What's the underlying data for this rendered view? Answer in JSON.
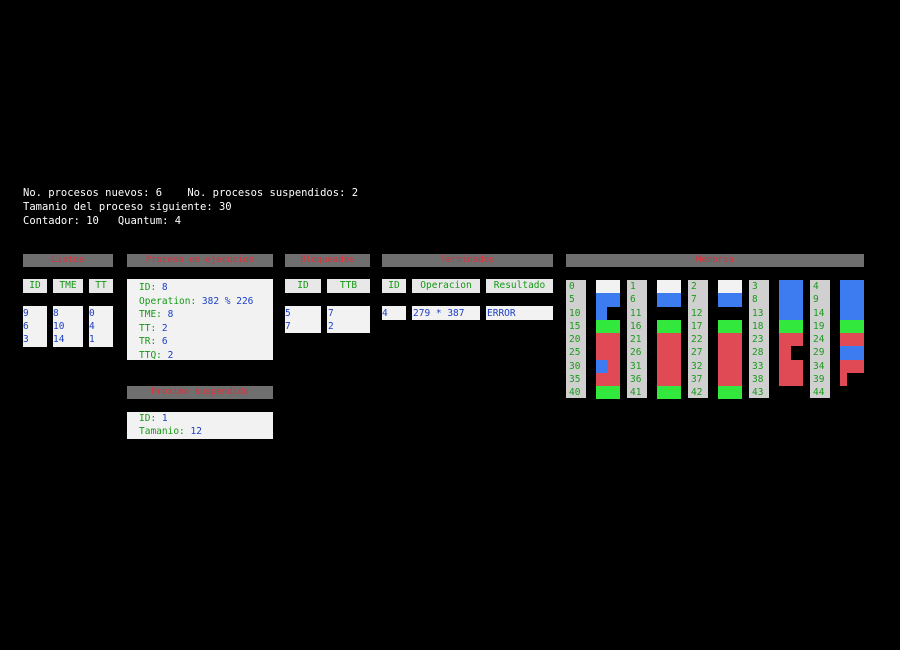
{
  "info": {
    "line1": "No. procesos nuevos: 6    No. procesos suspendidos: 2",
    "line2": "Tamanio del proceso siguiente: 30",
    "line3": "Contador: 10   Quantum: 4"
  },
  "listos": {
    "title": "Listos",
    "columns": [
      "ID",
      "TME",
      "TT"
    ],
    "rows": [
      [
        "9",
        "8",
        "0"
      ],
      [
        "6",
        "10",
        "4"
      ],
      [
        "3",
        "14",
        "1"
      ]
    ]
  },
  "ejecucion": {
    "title": "Proceso en ejecucion",
    "fields": [
      {
        "label": "ID: ",
        "value": "8"
      },
      {
        "label": "Operation: ",
        "value": "382 % 226"
      },
      {
        "label": "TME: ",
        "value": "8"
      },
      {
        "label": "TT: ",
        "value": "2"
      },
      {
        "label": "TR: ",
        "value": "6"
      },
      {
        "label": "TTQ: ",
        "value": "2"
      }
    ]
  },
  "suspendido": {
    "title": "Proximo suspendido",
    "fields": [
      {
        "label": "ID: ",
        "value": "1"
      },
      {
        "label": "Tamanio: ",
        "value": "12"
      }
    ]
  },
  "bloqueados": {
    "title": "Bloqueados",
    "columns": [
      "ID",
      "TTB"
    ],
    "rows": [
      [
        "5",
        "7"
      ],
      [
        "7",
        "2"
      ]
    ]
  },
  "terminados": {
    "title": "Terminados",
    "columns": [
      "ID",
      "Operacion",
      "Resultado"
    ],
    "rows": [
      [
        "4",
        "279 * 387",
        "ERROR"
      ]
    ]
  },
  "memoria": {
    "title": "Memoria",
    "colors": {
      "white": "#f2f2f2",
      "blue": "#3d7cf0",
      "green": "#33e83d",
      "red": "#e04a55",
      "black": "#000000"
    },
    "columns": [
      {
        "labels": [
          "0",
          "5",
          "10",
          "15",
          "20",
          "25",
          "30",
          "35",
          "40"
        ],
        "fill": [
          [
            "white",
            1.0
          ],
          [
            "blue",
            0.5
          ],
          [
            "black",
            0.5
          ]
        ]
      },
      {
        "labels": [
          "1",
          "6",
          "11",
          "16",
          "21",
          "26",
          "31",
          "36",
          "41"
        ],
        "fill": [
          [
            "white",
            1.0
          ],
          [
            "blue",
            1.0
          ]
        ]
      },
      {
        "labels": [
          "2",
          "7",
          "12",
          "17",
          "22",
          "27",
          "32",
          "37",
          "42"
        ],
        "fill": [
          [
            "white",
            1.0
          ],
          [
            "blue",
            1.0
          ]
        ]
      },
      {
        "labels": [
          "3",
          "8",
          "13",
          "18",
          "23",
          "28",
          "33",
          "38",
          "43"
        ],
        "fill": [
          [
            "blue",
            3.0
          ]
        ]
      },
      {
        "labels": [
          "4",
          "9",
          "14",
          "19",
          "24",
          "29",
          "34",
          "39",
          "44"
        ],
        "fill": [
          [
            "blue",
            3.0
          ]
        ]
      }
    ],
    "rows_fill": {
      "col0": [
        "white",
        "blue",
        "blue-half",
        "green",
        "red",
        "red",
        "blue-red",
        "red",
        "green"
      ],
      "col1": [
        "white",
        "blue",
        "black",
        "green",
        "red",
        "red",
        "red",
        "red",
        "green"
      ],
      "col2": [
        "white",
        "blue",
        "black",
        "green",
        "red",
        "red",
        "red",
        "red",
        "green"
      ],
      "col3": [
        "blue",
        "blue",
        "blue",
        "green",
        "red",
        "red-half",
        "red",
        "red",
        "black"
      ],
      "col4": [
        "blue",
        "blue",
        "blue",
        "green",
        "red",
        "blue",
        "red",
        "red-half",
        "black"
      ]
    }
  }
}
